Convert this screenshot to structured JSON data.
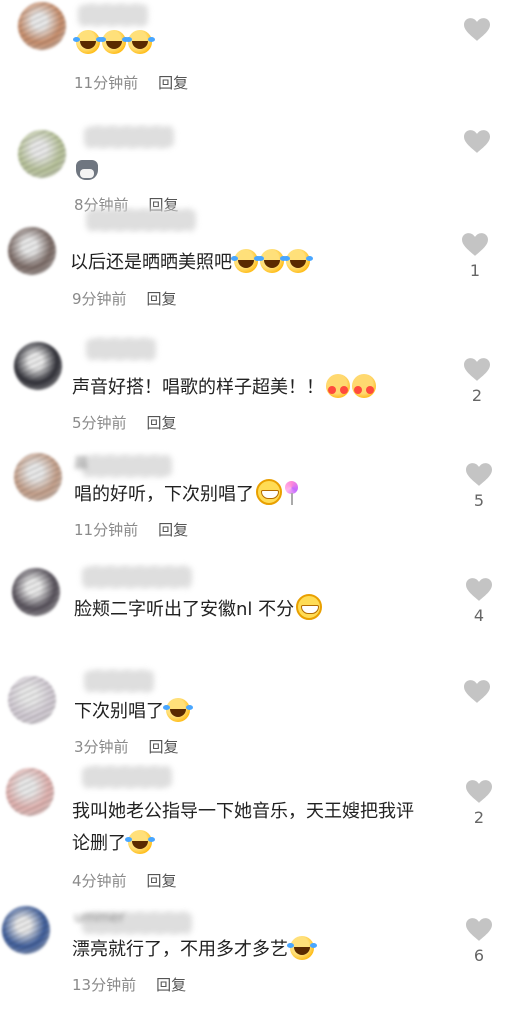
{
  "comments": [
    {
      "name": "",
      "avatar_color": "#c98d6a",
      "text": "",
      "emojis": [
        "laugh",
        "laugh",
        "laugh"
      ],
      "time": "11分钟前",
      "reply": "回复",
      "likes": ""
    },
    {
      "name": "",
      "avatar_color": "#b9c49a",
      "text": "",
      "emojis": [
        "cat"
      ],
      "time": "8分钟前",
      "reply": "回复",
      "likes": ""
    },
    {
      "name": "",
      "avatar_color": "#7c6b66",
      "text": "以后还是晒晒美照吧",
      "emojis": [
        "laugh",
        "laugh",
        "laugh"
      ],
      "time": "9分钟前",
      "reply": "回复",
      "likes": "1"
    },
    {
      "name": "",
      "avatar_color": "#2e2e36",
      "text": "声音好搭！唱歌的样子超美！！",
      "emojis": [
        "hug",
        "hug"
      ],
      "time": "5分钟前",
      "reply": "回复",
      "likes": "2"
    },
    {
      "name": "晨",
      "avatar_color": "#c6a08a",
      "text": "唱的好听，下次别唱了",
      "emojis": [
        "grin",
        "lolly"
      ],
      "time": "11分钟前",
      "reply": "回复",
      "likes": "5"
    },
    {
      "name": "",
      "avatar_color": "#56505a",
      "text": "脸颊二字听出了安徽nl 不分",
      "emojis": [
        "grin"
      ],
      "time": "",
      "reply": "",
      "likes": "4"
    },
    {
      "name": "",
      "avatar_color": "#d4cdd6",
      "text": "下次别唱了",
      "emojis": [
        "laugh"
      ],
      "time": "3分钟前",
      "reply": "回复",
      "likes": ""
    },
    {
      "name": "",
      "avatar_color": "#e3b3b0",
      "text": "我叫她老公指导一下她音乐，天王嫂把我评",
      "text2": "论删了",
      "emojis": [
        "laugh"
      ],
      "time": "4分钟前",
      "reply": "回复",
      "likes": "2"
    },
    {
      "name": "ummer",
      "avatar_color": "#3a5a9a",
      "text": "漂亮就行了，不用多才多艺",
      "emojis": [
        "laugh"
      ],
      "time": "13分钟前",
      "reply": "回复",
      "likes": "6"
    }
  ],
  "icons": {
    "like": "heart-icon"
  },
  "colors": {
    "heart": "#c4c4c4",
    "text": "#222222",
    "meta": "#8a8a8a"
  }
}
